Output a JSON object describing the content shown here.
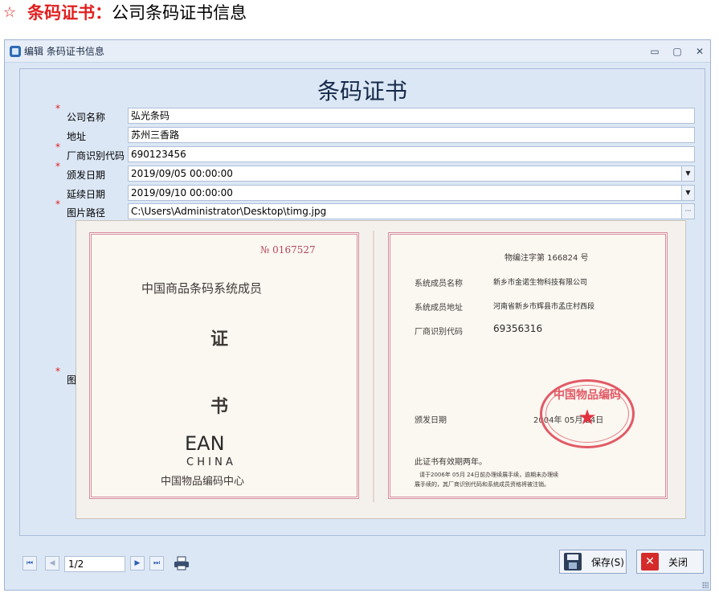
{
  "page_header": {
    "star": "☆",
    "title_bold": "条码证书：",
    "title_rest": "公司条码证书信息"
  },
  "window": {
    "title": "编辑 条码证书信息",
    "controls": {
      "minimize": "▭",
      "maximize": "▢",
      "close": "✕"
    },
    "form_title": "条码证书",
    "fields": {
      "company_name": {
        "required": "*",
        "label": "公司名称",
        "value": "弘光条码"
      },
      "address": {
        "required": "",
        "label": "地址",
        "value": "苏州三香路"
      },
      "vendor_code": {
        "required": "*",
        "label": "厂商识别代码",
        "value": "690123456"
      },
      "issue_date": {
        "required": "*",
        "label": "颁发日期",
        "value": "2019/09/05 00:00:00"
      },
      "renew_date": {
        "required": "",
        "label": "延续日期",
        "value": "2019/09/10 00:00:00"
      },
      "image_path": {
        "required": "*",
        "label": "图片路径",
        "value": "C:\\Users\\Administrator\\Desktop\\timg.jpg"
      },
      "image": {
        "required": "*",
        "label": "图片"
      }
    },
    "certificate": {
      "number": "№ 0167527",
      "member_title": "中国商品条码系统成员",
      "char1": "证",
      "char2": "书",
      "ean_logo": "EAN",
      "china_logo": "C H I N A",
      "center_name": "中国物品编码中心",
      "reg_no": "物编注字第    166824  号",
      "member_name_label": "系统成员名称",
      "member_name": "新乡市金诺生物科技有限公司",
      "member_address_label": "系统成员地址",
      "member_address": "河南省新乡市辉县市孟庄村西段",
      "vendor_code_label": "厂商识别代码",
      "vendor_code": "69356316",
      "issue_label": "颁发日期",
      "issue_date": "2004年 05月 24日",
      "seal_text": "中国物品编码",
      "seal_star": "★",
      "validity": "此证书有效期两年。",
      "note1": "请于2006年 05月 24日前办理续展手续，逾期未办理续",
      "note2": "展手续的，其厂商识别代码和系统成员资格将被注销。"
    },
    "pager": {
      "first": "⏮",
      "prev": "◀",
      "page": "1/2",
      "next": "▶",
      "last": "⏭"
    },
    "buttons": {
      "save": "保存(S)",
      "close": "关闭"
    }
  }
}
